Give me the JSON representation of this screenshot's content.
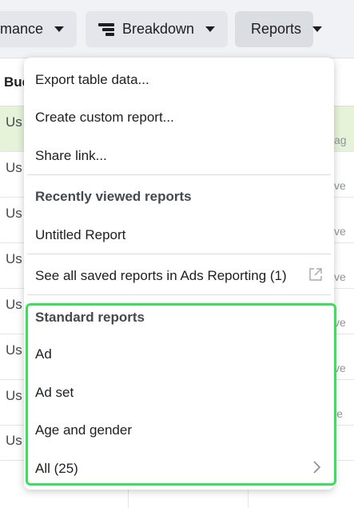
{
  "toolbar": {
    "performance_label": "mance",
    "breakdown_label": "Breakdown",
    "reports_label": "Reports"
  },
  "table": {
    "header_label": "Bud",
    "rows": [
      "Us",
      "Us",
      "Us",
      "Us",
      "Us",
      "Us",
      "Us",
      "Us"
    ],
    "right_fragments": [
      "ag",
      "ve",
      "ve",
      "ve",
      "ve",
      "ve",
      "le"
    ]
  },
  "menu": {
    "export": "Export table data...",
    "create_custom": "Create custom report...",
    "share_link": "Share link...",
    "recent_heading": "Recently viewed reports",
    "untitled": "Untitled Report",
    "see_all": "See all saved reports in Ads Reporting (1)",
    "standard_heading": "Standard reports",
    "standard_items": [
      "Ad",
      "Ad set",
      "Age and gender"
    ],
    "all_label": "All (25)"
  },
  "colors": {
    "highlight": "#3be05a",
    "first_row_bg": "#e6f3d9"
  },
  "icons": [
    "caret-down-icon",
    "breakdown-icon",
    "external-link-icon",
    "chevron-right-icon"
  ]
}
